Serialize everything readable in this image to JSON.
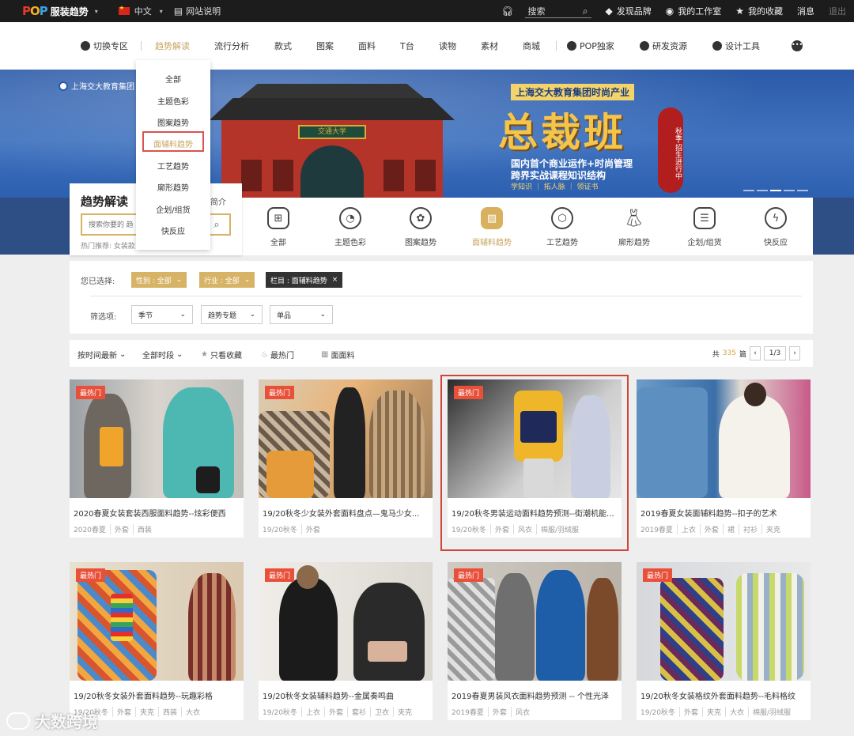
{
  "topbar": {
    "logo_pop": "POP",
    "logo_text": "服装趋势",
    "language": "中文",
    "site_guide": "网站说明",
    "search_label": "搜索",
    "discover": "发现品牌",
    "workspace": "我的工作室",
    "favorites": "我的收藏",
    "messages": "消息",
    "logout": "退出"
  },
  "nav": {
    "items": [
      "切换专区",
      "趋势解读",
      "流行分析",
      "款式",
      "图案",
      "面料",
      "T台",
      "读物",
      "素材",
      "商城",
      "POP独家",
      "研发资源",
      "设计工具"
    ],
    "more": "•••"
  },
  "dropdown": {
    "items": [
      "全部",
      "主题色彩",
      "图案趋势",
      "面辅料趋势",
      "工艺趋势",
      "廓形趋势",
      "企划/组货",
      "快反应"
    ]
  },
  "banner": {
    "tag": "上海交大教育集团",
    "plaque": "交通大学",
    "line1": "上海交大教育集团时尚产业",
    "headline": "总裁班",
    "sub1": "国内首个商业运作+时尚管理",
    "sub2": "跨界实战课程知识结构",
    "sub3": "学知识 ｜ 拓人脉 ｜ 领证书",
    "ribbon": "秋季·招生进行中"
  },
  "trend_box": {
    "title": "趋势解读",
    "intro": "简介",
    "search_placeholder": "搜索你要的 趋",
    "hot": "热门推荐: 女装款"
  },
  "categories": [
    {
      "label": "全部",
      "icon": "grid-icon"
    },
    {
      "label": "主题色彩",
      "icon": "palette-icon"
    },
    {
      "label": "图案趋势",
      "icon": "flower-icon"
    },
    {
      "label": "面辅料趋势",
      "icon": "fabric-icon"
    },
    {
      "label": "工艺趋势",
      "icon": "hexagon-icon"
    },
    {
      "label": "廓形趋势",
      "icon": "dress-icon"
    },
    {
      "label": "企划/组货",
      "icon": "plan-icon"
    },
    {
      "label": "快反应",
      "icon": "lightning-icon"
    }
  ],
  "filters": {
    "selected_label": "您已选择:",
    "chips": [
      "性别 : 全部",
      "行业 : 全部",
      "栏目 : 面辅料趋势"
    ],
    "options_label": "筛选项:",
    "selects": [
      "季节",
      "趋势专题",
      "单品"
    ]
  },
  "sort": {
    "latest": "按时间最新",
    "period": "全部时段",
    "fav_only": "只看收藏",
    "hottest": "最热门",
    "fabric": "面面料",
    "total_prefix": "共",
    "total": "335",
    "total_suffix": "篇",
    "page": "1/3"
  },
  "cards": [
    {
      "badge": "最热门",
      "title": "2020春夏女装套装西服面料趋势--炫彩便西",
      "tags": [
        "2020春夏",
        "外套",
        "西装"
      ]
    },
    {
      "badge": "最热门",
      "title": "19/20秋冬少女装外套面料盘点—鬼马少女...",
      "tags": [
        "19/20秋冬",
        "外套"
      ]
    },
    {
      "badge": "最热门",
      "title": "19/20秋冬男装运动面料趋势预测--街潮机能...",
      "tags": [
        "19/20秋冬",
        "外套",
        "风衣",
        "棉服/羽绒服"
      ]
    },
    {
      "badge": "",
      "title": "2019春夏女装面辅料趋势--扣子的艺术",
      "tags": [
        "2019春夏",
        "上衣",
        "外套",
        "裙",
        "衬衫",
        "夹克"
      ]
    },
    {
      "badge": "最热门",
      "title": "19/20秋冬女装外套面料趋势--玩趣彩格",
      "tags": [
        "19/20秋冬",
        "外套",
        "夹克",
        "西装",
        "大衣"
      ]
    },
    {
      "badge": "最热门",
      "title": "19/20秋冬女装辅料趋势--金属奏鸣曲",
      "tags": [
        "19/20秋冬",
        "上衣",
        "外套",
        "套衫",
        "卫衣",
        "夹克"
      ]
    },
    {
      "badge": "最热门",
      "title": "2019春夏男装风衣面料趋势预测 -- 个性光泽",
      "tags": [
        "2019春夏",
        "外套",
        "风衣"
      ]
    },
    {
      "badge": "最热门",
      "title": "19/20秋冬女装格纹外套面料趋势--毛料格纹",
      "tags": [
        "19/20秋冬",
        "外套",
        "夹克",
        "大衣",
        "棉服/羽绒服"
      ]
    }
  ],
  "watermark": "大数跨境",
  "colors": {
    "accent": "#d7b365",
    "hot_badge": "#e8503a",
    "highlight": "#cf4538"
  }
}
